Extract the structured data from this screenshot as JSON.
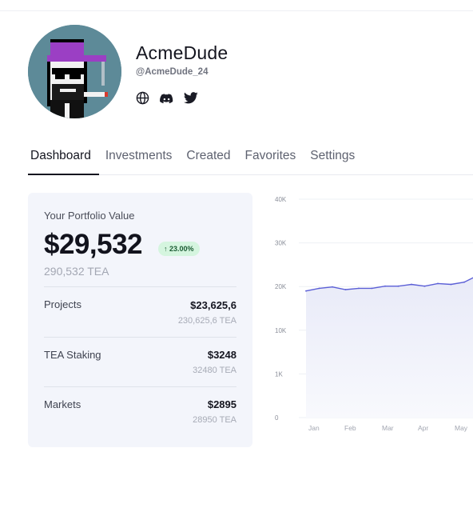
{
  "profile": {
    "name": "AcmeDude",
    "handle": "@AcmeDude_24",
    "socials": [
      "globe-icon",
      "discord-icon",
      "twitter-icon"
    ]
  },
  "tabs": [
    {
      "label": "Dashboard",
      "active": true
    },
    {
      "label": "Investments",
      "active": false
    },
    {
      "label": "Created",
      "active": false
    },
    {
      "label": "Favorites",
      "active": false
    },
    {
      "label": "Settings",
      "active": false
    }
  ],
  "portfolio": {
    "title": "Your Portfolio Value",
    "value": "$29,532",
    "change": "↑ 23.00%",
    "tea": "290,532 TEA",
    "rows": [
      {
        "label": "Projects",
        "value": "$23,625,6",
        "tea": "230,625,6 TEA"
      },
      {
        "label": "TEA Staking",
        "value": "$3248",
        "tea": "32480 TEA"
      },
      {
        "label": "Markets",
        "value": "$2895",
        "tea": "28950 TEA"
      }
    ]
  },
  "chart_data": {
    "type": "area",
    "categories": [
      "Jan",
      "Feb",
      "Mar",
      "Apr",
      "May"
    ],
    "y_tick_labels": [
      "40K",
      "30K",
      "20K",
      "10K",
      "1K",
      "0"
    ],
    "x": [
      "Jan",
      "",
      "",
      "Feb",
      "",
      "",
      "Mar",
      "",
      "",
      "Apr",
      "",
      "",
      "May",
      ""
    ],
    "values": [
      19000,
      19600,
      19900,
      19300,
      19600,
      19600,
      20100,
      20100,
      20500,
      20100,
      20700,
      20500,
      21000,
      22500
    ],
    "grid": true,
    "line_color": "#5b5fd6",
    "fill_color": "#eceefa"
  }
}
